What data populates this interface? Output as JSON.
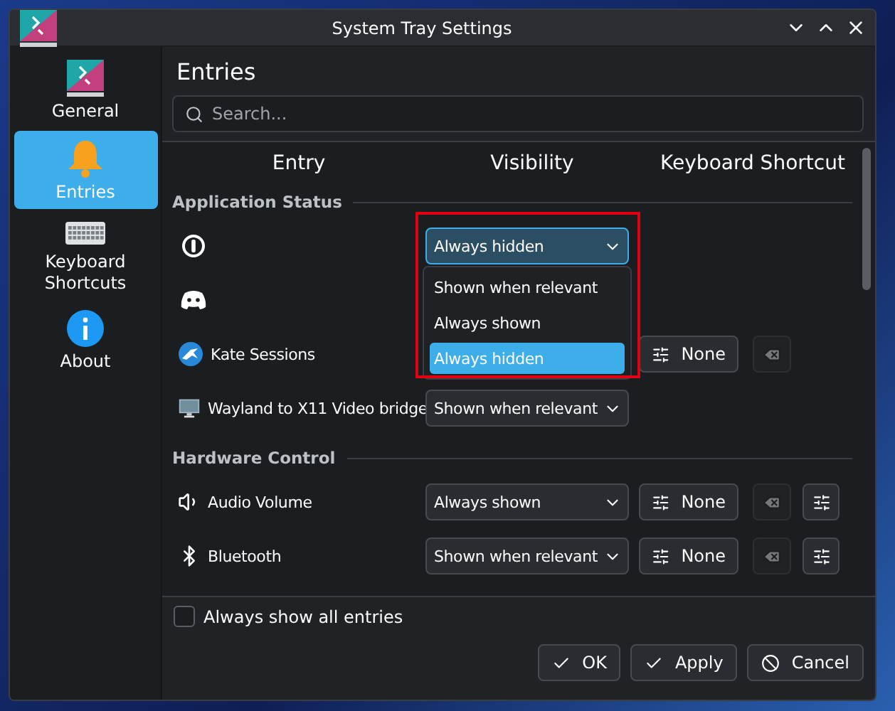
{
  "window": {
    "title": "System Tray Settings"
  },
  "sidebar": {
    "items": [
      {
        "label": "General",
        "selected": false
      },
      {
        "label": "Entries",
        "selected": true
      },
      {
        "label": "Keyboard Shortcuts",
        "selected": false
      },
      {
        "label": "About",
        "selected": false
      }
    ]
  },
  "page": {
    "heading": "Entries"
  },
  "search": {
    "placeholder": "Search..."
  },
  "table": {
    "columns": [
      "Entry",
      "Visibility",
      "Keyboard Shortcut"
    ],
    "sections": [
      {
        "title": "Application Status",
        "entries": [
          {
            "kind": "icon-only",
            "visibility": "Always hidden",
            "open": true,
            "highlighted": true,
            "options": [
              {
                "label": "Shown when relevant",
                "selected": false
              },
              {
                "label": "Always shown",
                "selected": false
              },
              {
                "label": "Always hidden",
                "selected": true
              }
            ]
          },
          {
            "kind": "icon-only"
          },
          {
            "name": "Kate Sessions",
            "shortcut": "None",
            "clear": {
              "disabled": true
            }
          },
          {
            "name": "Wayland to X11 Video bridge",
            "visibility": "Shown when relevant",
            "open": false
          }
        ]
      },
      {
        "title": "Hardware Control",
        "entries": [
          {
            "name": "Audio Volume",
            "visibility": "Always shown",
            "open": false,
            "shortcut": "None",
            "clear": {
              "disabled": true
            },
            "configure": true
          },
          {
            "name": "Bluetooth",
            "visibility": "Shown when relevant",
            "open": false,
            "shortcut": "None",
            "clear": {
              "disabled": true
            },
            "configure": true
          }
        ]
      }
    ]
  },
  "footer": {
    "checkbox": {
      "label": "Always show all entries",
      "checked": false
    }
  },
  "buttons": [
    {
      "label": "OK",
      "kind": "accept"
    },
    {
      "label": "Apply",
      "kind": "accept"
    },
    {
      "label": "Cancel",
      "kind": "reject"
    }
  ]
}
